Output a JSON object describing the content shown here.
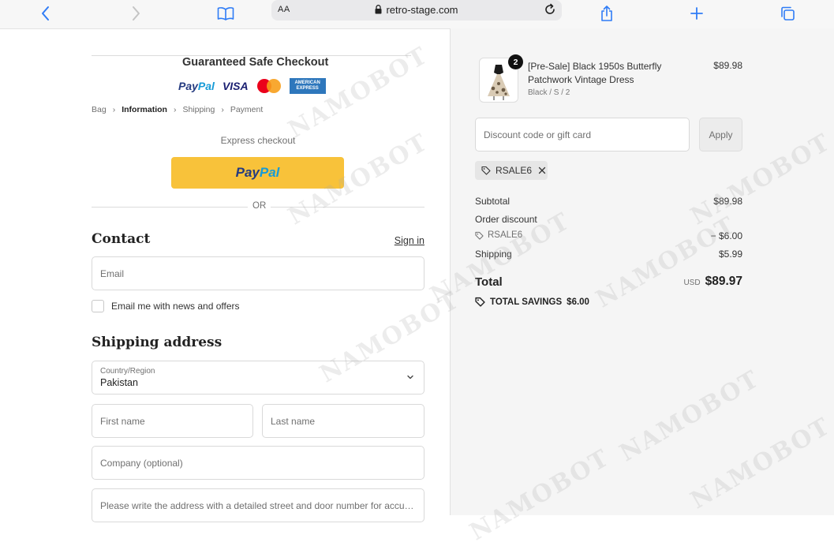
{
  "browser": {
    "text_size_label": "AA",
    "url": "retro-stage.com"
  },
  "checkout": {
    "guarantee_title": "Guaranteed Safe Checkout",
    "payment_logos": [
      "PayPal",
      "VISA",
      "MasterCard",
      "AMERICAN EXPRESS"
    ],
    "breadcrumb": [
      "Bag",
      "Information",
      "Shipping",
      "Payment"
    ],
    "express_label": "Express checkout",
    "paypal_button": {
      "part1": "Pay",
      "part2": "Pal"
    },
    "or_label": "OR"
  },
  "contact": {
    "heading": "Contact",
    "sign_in": "Sign in",
    "email_placeholder": "Email",
    "newsletter_label": "Email me with news and offers"
  },
  "shipping": {
    "heading": "Shipping address",
    "country_label": "Country/Region",
    "country_value": "Pakistan",
    "first_name_placeholder": "First name",
    "last_name_placeholder": "Last name",
    "company_placeholder": "Company (optional)",
    "address_placeholder": "Please write the address with a detailed street and door number for accurate delivery"
  },
  "summary": {
    "product": {
      "quantity": "2",
      "name": "[Pre-Sale] Black 1950s Butterfly Patchwork Vintage Dress",
      "variant": "Black / S / 2",
      "price": "$89.98"
    },
    "discount_placeholder": "Discount code or gift card",
    "apply_label": "Apply",
    "applied_code": "RSALE6",
    "subtotal_label": "Subtotal",
    "subtotal_value": "$89.98",
    "order_discount_label": "Order discount",
    "discount_code": "RSALE6",
    "discount_value": "− $6.00",
    "shipping_label": "Shipping",
    "shipping_value": "$5.99",
    "total_label": "Total",
    "currency": "USD",
    "total_value": "$89.97",
    "savings_label": "TOTAL SAVINGS",
    "savings_value": "$6.00"
  },
  "watermark_text": "NAMOBOT"
}
